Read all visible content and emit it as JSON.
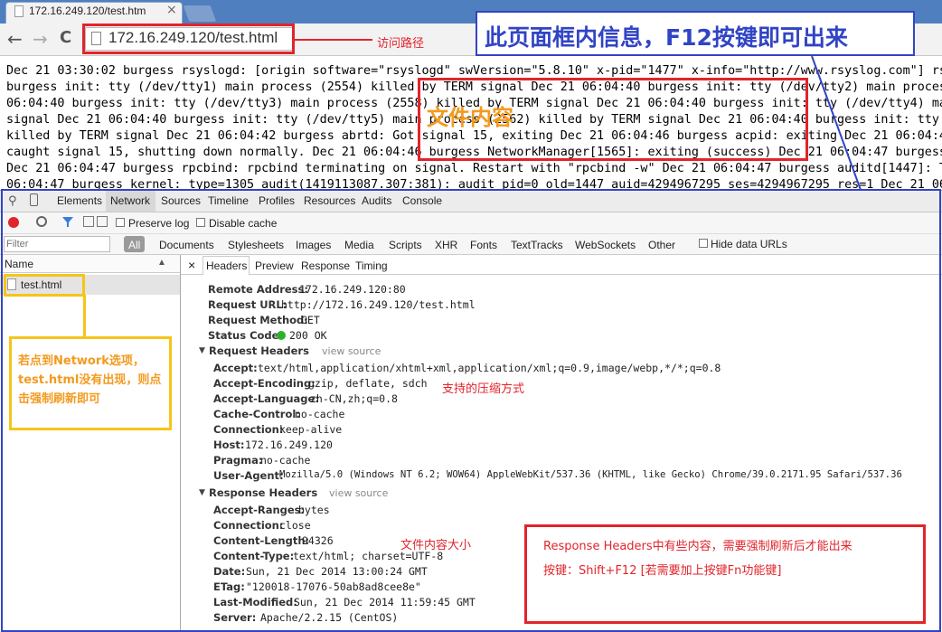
{
  "browser": {
    "tab_title": "172.16.249.120/test.htm",
    "tab_close": "×",
    "url": "172.16.249.120/test.html",
    "back": "←",
    "forward": "→",
    "reload": "C"
  },
  "page_lines": [
    "Dec 21 03:30:02 burgess rsyslogd: [origin software=\"rsyslogd\" swVersion=\"5.8.10\" x-pid=\"1477\" x-info=\"http://www.rsyslog.com\"] rs",
    "burgess init: tty (/dev/tty1) main process (2554) killed by TERM signal Dec 21 06:04:40 burgess init: tty (/dev/tty2) main process",
    "06:04:40 burgess init: tty (/dev/tty3) main process (2558) killed by TERM signal Dec 21 06:04:40 burgess init: tty (/dev/tty4) mai",
    "signal Dec 21 06:04:40 burgess init: tty (/dev/tty5) main process (2562) killed by TERM signal Dec 21 06:04:40 burgess init: tty",
    "killed by TERM signal Dec 21 06:04:42 burgess abrtd: Got signal 15, exiting Dec 21 06:04:46 burgess acpid: exiting Dec 21 06:04:4",
    "caught signal 15, shutting down normally. Dec 21 06:04:46 burgess NetworkManager[1565]: exiting (success) Dec 21 06:04:47 burgess",
    "Dec 21 06:04:47 burgess rpcbind: rpcbind terminating on signal. Restart with \"rpcbind -w\" Dec 21 06:04:47 burgess auditd[1447]: Th",
    "06:04:47 burgess kernel: type=1305 audit(1419113087.307:381): audit pid=0 old=1447 auid=4294967295 ses=4294967295 res=1 Dec 21 06"
  ],
  "annotations": {
    "url_note": "访问路径",
    "f12_note": "此页面框内信息，F12按键即可出来",
    "file_content": "文件内容",
    "network_note": "若点到Network选项，test.html没有出现，则点击强制刷新即可",
    "compress_note": "支持的压缩方式",
    "size_note": "文件内容大小",
    "response_note_line1": "Response Headers中有些内容，需要强制刷新后才能出来",
    "response_note_line2": "按键：Shift+F12 [若需要加上按键Fn功能键]"
  },
  "devtools": {
    "tabs": [
      "Elements",
      "Network",
      "Sources",
      "Timeline",
      "Profiles",
      "Resources",
      "Audits",
      "Console"
    ],
    "active_tab": "Network",
    "preserve_log": "Preserve log",
    "disable_cache": "Disable cache",
    "filter_placeholder": "Filter",
    "filter_types": [
      "All",
      "Documents",
      "Stylesheets",
      "Images",
      "Media",
      "Scripts",
      "XHR",
      "Fonts",
      "TextTracks",
      "WebSockets",
      "Other"
    ],
    "hide_data_urls": "Hide data URLs",
    "name_header": "Name",
    "sort_icon": "▲",
    "request_name": "test.html",
    "detail_close": "×",
    "detail_tabs": [
      "Headers",
      "Preview",
      "Response",
      "Timing"
    ],
    "general": [
      {
        "k": "Remote Address:",
        "v": "172.16.249.120:80"
      },
      {
        "k": "Request URL:",
        "v": "http://172.16.249.120/test.html"
      },
      {
        "k": "Request Method:",
        "v": "GET"
      },
      {
        "k": "Status Code:",
        "v": "200 OK"
      }
    ],
    "status_color": "#2cb12c",
    "request_headers_title": "Request Headers",
    "view_source": "view source",
    "request_headers": [
      {
        "k": "Accept:",
        "v": "text/html,application/xhtml+xml,application/xml;q=0.9,image/webp,*/*;q=0.8"
      },
      {
        "k": "Accept-Encoding:",
        "v": "gzip, deflate, sdch"
      },
      {
        "k": "Accept-Language:",
        "v": "zh-CN,zh;q=0.8"
      },
      {
        "k": "Cache-Control:",
        "v": "no-cache"
      },
      {
        "k": "Connection:",
        "v": "keep-alive"
      },
      {
        "k": "Host:",
        "v": "172.16.249.120"
      },
      {
        "k": "Pragma:",
        "v": "no-cache"
      },
      {
        "k": "User-Agent:",
        "v": "Mozilla/5.0 (Windows NT 6.2; WOW64) AppleWebKit/537.36 (KHTML, like Gecko) Chrome/39.0.2171.95 Safari/537.36"
      }
    ],
    "response_headers_title": "Response Headers",
    "response_headers": [
      {
        "k": "Accept-Ranges:",
        "v": "bytes"
      },
      {
        "k": "Connection:",
        "v": "close"
      },
      {
        "k": "Content-Length:",
        "v": "94326"
      },
      {
        "k": "Content-Type:",
        "v": "text/html; charset=UTF-8"
      },
      {
        "k": "Date:",
        "v": "Sun, 21 Dec 2014 13:00:24 GMT"
      },
      {
        "k": "ETag:",
        "v": "\"120018-17076-50ab8ad8cee8e\""
      },
      {
        "k": "Last-Modified:",
        "v": "Sun, 21 Dec 2014 11:59:45 GMT"
      },
      {
        "k": "Server:",
        "v": "Apache/2.2.15 (CentOS)"
      }
    ]
  },
  "colors": {
    "annotation_red": "#e2242b",
    "annotation_blue": "#3144c5",
    "annotation_yellow": "#f5c518",
    "file_content_orange": "#f39a1e"
  }
}
